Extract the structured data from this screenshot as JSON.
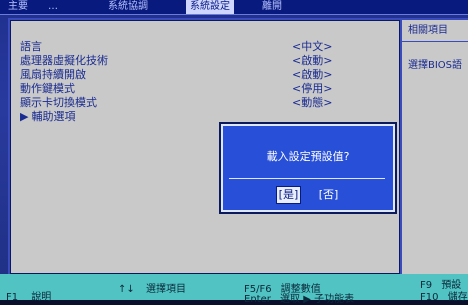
{
  "tabs": [
    "主要",
    "…",
    "系統協調",
    "系統設定",
    "離開"
  ],
  "active_tab_index": 3,
  "settings": {
    "rows": [
      {
        "label": "語言",
        "value": "<中文>"
      },
      {
        "label": "處理器虛擬化技術",
        "value": "<啟動>"
      },
      {
        "label": "風扇持續開啟",
        "value": "<啟動>"
      },
      {
        "label": "動作鍵模式",
        "value": "<停用>"
      },
      {
        "label": "顯示卡切換模式",
        "value": "<動態>"
      },
      {
        "label": "輔助選項",
        "value": ""
      }
    ]
  },
  "help": {
    "title": "相關項目",
    "text": "選擇BIOS語"
  },
  "dialog": {
    "message": "載入設定預設值?",
    "yes_label": "[是]",
    "no_label": "[否]"
  },
  "bottom_bar": {
    "items": [
      {
        "key": "F1",
        "label": "說明"
      },
      {
        "key": "↑↓",
        "label": "選擇項目"
      },
      {
        "key": "F5/F6",
        "label": "調整數值"
      },
      {
        "key": "Enter",
        "label": "選取 ▶ 子功能表"
      },
      {
        "key": "F9",
        "label": "預設"
      },
      {
        "key": "F10",
        "label": "儲存"
      }
    ]
  }
}
